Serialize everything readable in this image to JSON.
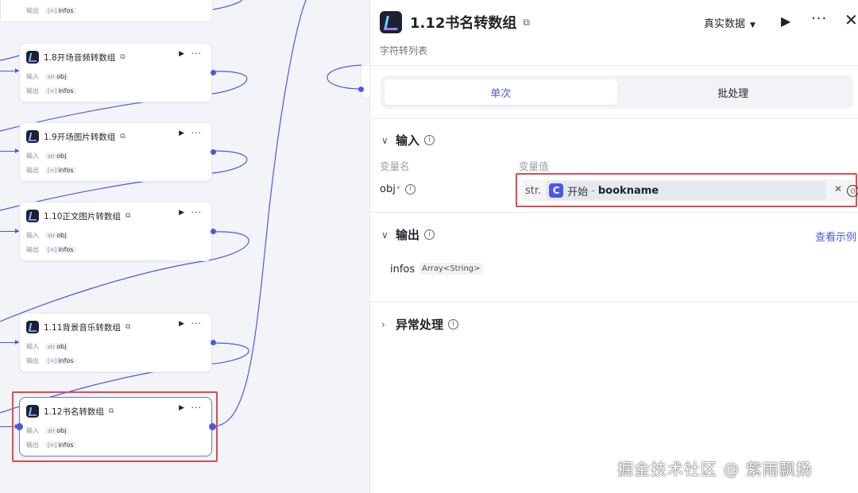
{
  "canvas": {
    "top_stub": {
      "output_label": "输出",
      "output_type_icon": "list-icon",
      "output_var": "infos"
    },
    "nodes": [
      {
        "title": "1.8开场音频转数组",
        "input_label": "输入",
        "input_type": "str",
        "input_var": "obj",
        "output_label": "输出",
        "output_type": "list",
        "output_var": "infos"
      },
      {
        "title": "1.9开场图片转数组",
        "input_label": "输入",
        "input_type": "str",
        "input_var": "obj",
        "output_label": "输出",
        "output_type": "list",
        "output_var": "infos"
      },
      {
        "title": "1.10正文图片转数组",
        "input_label": "输入",
        "input_type": "str",
        "input_var": "obj",
        "output_label": "输出",
        "output_type": "list",
        "output_var": "infos"
      },
      {
        "title": "1.11背景音乐转数组",
        "input_label": "输入",
        "input_type": "str",
        "input_var": "obj",
        "output_label": "输出",
        "output_type": "list",
        "output_var": "infos"
      },
      {
        "title": "1.12书名转数组",
        "input_label": "输入",
        "input_type": "str",
        "input_var": "obj",
        "output_label": "输出",
        "output_type": "list",
        "output_var": "infos",
        "selected": true
      }
    ],
    "highlight_color": "#e5484d",
    "wire_color": "#4c57e3"
  },
  "panel": {
    "title": "1.12书名转数组",
    "description": "字符转列表",
    "mode_select": "真实数据",
    "tabs": [
      {
        "label": "单次",
        "active": true
      },
      {
        "label": "批处理",
        "active": false
      }
    ],
    "input_section": {
      "title": "输入",
      "col_name_label": "变量名",
      "col_value_label": "变量值",
      "field_name": "obj",
      "required_mark": "*",
      "value_type": "str.",
      "ref_icon_letter": "C",
      "ref_node": "开始",
      "ref_sep": "-",
      "ref_var": "bookname"
    },
    "output_section": {
      "title": "输出",
      "see_example_label": "查看示例",
      "var_name": "infos",
      "var_type": "Array<String>"
    },
    "error_section": {
      "title": "异常处理"
    },
    "accent_color": "#4c57e3"
  },
  "watermark": "掘金技术社区 @ 紫雨飘扬"
}
